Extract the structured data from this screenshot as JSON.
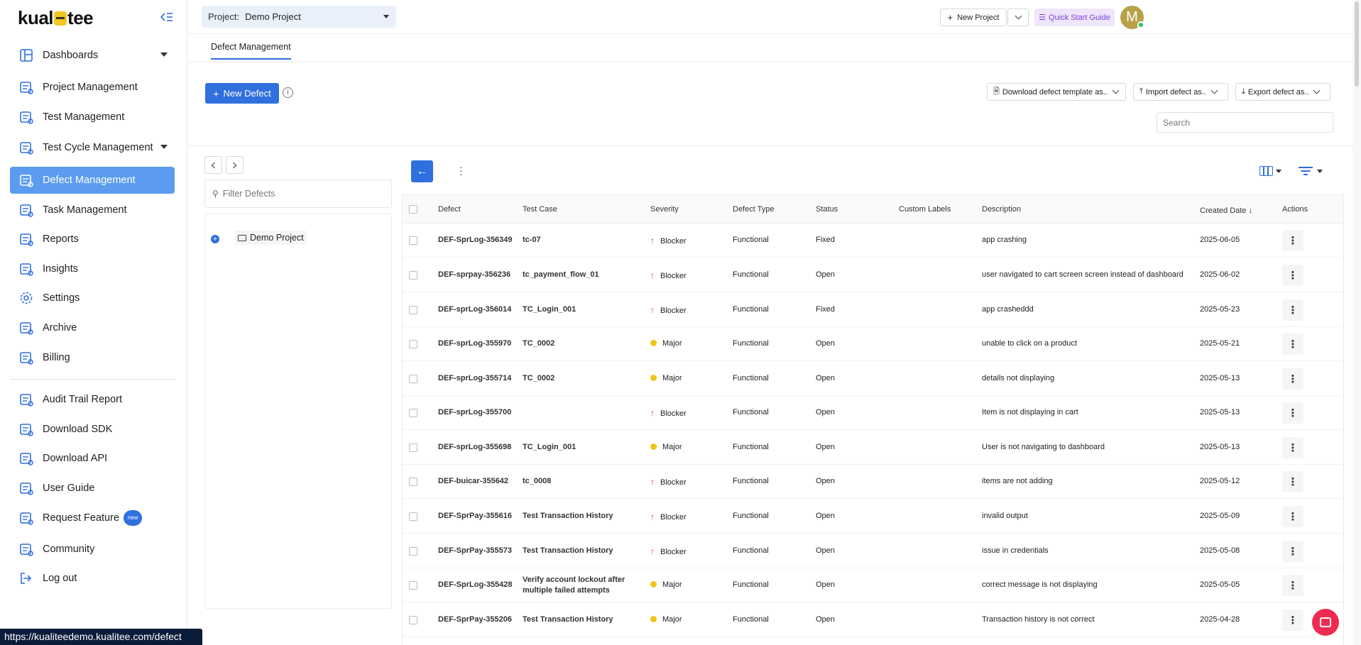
{
  "brand": {
    "logo_pre": "kual",
    "logo_post": "tee"
  },
  "sidebar": {
    "items": [
      {
        "label": "Dashboards",
        "icon": "layout-icon",
        "caret": true
      },
      {
        "label": "Project Management",
        "icon": "project-icon"
      },
      {
        "label": "Test Management",
        "icon": "test-icon"
      },
      {
        "label": "Test Cycle Management",
        "icon": "flask-icon",
        "caret": true
      },
      {
        "label": "Defect Management",
        "icon": "defect-icon",
        "active": true
      },
      {
        "label": "Task Management",
        "icon": "task-icon"
      },
      {
        "label": "Reports",
        "icon": "report-icon"
      },
      {
        "label": "Insights",
        "icon": "insights-icon"
      },
      {
        "label": "Settings",
        "icon": "gear-icon"
      },
      {
        "label": "Archive",
        "icon": "archive-icon"
      },
      {
        "label": "Billing",
        "icon": "billing-icon"
      },
      {
        "label": "Audit Trail Report",
        "icon": "audit-icon"
      },
      {
        "label": "Download SDK",
        "icon": "sdk-icon"
      },
      {
        "label": "Download API",
        "icon": "api-icon"
      },
      {
        "label": "User Guide",
        "icon": "signpost-icon"
      },
      {
        "label": "Request Feature",
        "icon": "request-icon",
        "badge": "new"
      },
      {
        "label": "Community",
        "icon": "community-icon"
      },
      {
        "label": "Log out",
        "icon": "logout-icon"
      }
    ]
  },
  "topbar": {
    "project_label": "Project:",
    "project_value": "Demo Project",
    "new_project": "New Project",
    "quick_start": "Quick Start Guide",
    "avatar_initial": "M"
  },
  "tabs": [
    {
      "label": "Defect Management"
    }
  ],
  "actions": {
    "new_defect": "New Defect",
    "download_template": "Download defect template as..",
    "import": "Import defect as..",
    "export": "Export defect as..",
    "search_placeholder": "Search"
  },
  "tree": {
    "filter_placeholder": "Filter Defects",
    "root": "Demo Project"
  },
  "table": {
    "headers": [
      "Defect",
      "Test Case",
      "Severity",
      "Defect Type",
      "Status",
      "Custom Labels",
      "Description",
      "Created Date",
      "Actions"
    ],
    "rows": [
      {
        "defect": "DEF-SprLog-356349",
        "test_case": "tc-07",
        "severity": "Blocker",
        "type": "Functional",
        "status": "Fixed",
        "labels": "",
        "description": "app crashing",
        "date": "2025-06-05"
      },
      {
        "defect": "DEF-sprpay-356236",
        "test_case": "tc_payment_flow_01",
        "severity": "Blocker",
        "type": "Functional",
        "status": "Open",
        "labels": "",
        "description": "user navigated to cart screen screen instead of dashboard",
        "date": "2025-06-02"
      },
      {
        "defect": "DEF-sprLog-356014",
        "test_case": "TC_Login_001",
        "severity": "Blocker",
        "type": "Functional",
        "status": "Fixed",
        "labels": "",
        "description": "app crasheddd",
        "date": "2025-05-23"
      },
      {
        "defect": "DEF-sprLog-355970",
        "test_case": "TC_0002",
        "severity": "Major",
        "type": "Functional",
        "status": "Open",
        "labels": "",
        "description": "unable to click on a product",
        "date": "2025-05-21"
      },
      {
        "defect": "DEF-sprLog-355714",
        "test_case": "TC_0002",
        "severity": "Major",
        "type": "Functional",
        "status": "Open",
        "labels": "",
        "description": "details not displaying",
        "date": "2025-05-13"
      },
      {
        "defect": "DEF-sprLog-355700",
        "test_case": "",
        "severity": "Blocker",
        "type": "Functional",
        "status": "Open",
        "labels": "",
        "description": "Item is not displaying in cart",
        "date": "2025-05-13"
      },
      {
        "defect": "DEF-sprLog-355698",
        "test_case": "TC_Login_001",
        "severity": "Major",
        "type": "Functional",
        "status": "Open",
        "labels": "",
        "description": "User is not navigating to dashboard",
        "date": "2025-05-13"
      },
      {
        "defect": "DEF-buicar-355642",
        "test_case": "tc_0008",
        "severity": "Blocker",
        "type": "Functional",
        "status": "Open",
        "labels": "",
        "description": "items are not adding",
        "date": "2025-05-12"
      },
      {
        "defect": "DEF-SprPay-355616",
        "test_case": "Test Transaction History",
        "severity": "Blocker",
        "type": "Functional",
        "status": "Open",
        "labels": "",
        "description": "invalid output",
        "date": "2025-05-09"
      },
      {
        "defect": "DEF-SprPay-355573",
        "test_case": "Test Transaction History",
        "severity": "Blocker",
        "type": "Functional",
        "status": "Open",
        "labels": "",
        "description": "issue in credentials",
        "date": "2025-05-08"
      },
      {
        "defect": "DEF-SprLog-355428",
        "test_case": "Verify account lockout after multiple failed attempts",
        "severity": "Major",
        "type": "Functional",
        "status": "Open",
        "labels": "",
        "description": "correct message is not displaying",
        "date": "2025-05-05"
      },
      {
        "defect": "DEF-SprPay-355206",
        "test_case": "Test Transaction History",
        "severity": "Major",
        "type": "Functional",
        "status": "Open",
        "labels": "",
        "description": "Transaction history is not correct",
        "date": "2025-04-28"
      }
    ]
  },
  "status_url": "https://kualiteedemo.kualitee.com/defect",
  "colors": {
    "accent": "#2f6fde",
    "active_nav": "#5b9cf0",
    "blocker": "#d43a2f",
    "major": "#f0c419"
  }
}
